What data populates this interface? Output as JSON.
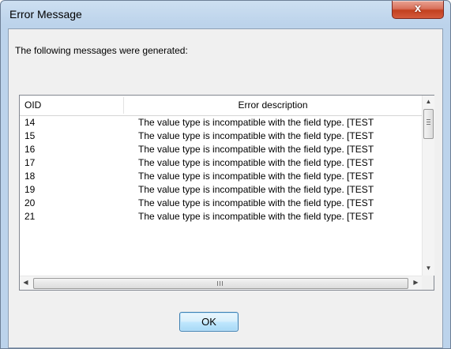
{
  "window": {
    "title": "Error Message",
    "close_label": "x"
  },
  "intro": "The following messages were generated:",
  "table": {
    "columns": [
      "OID",
      "Error description"
    ],
    "rows": [
      {
        "oid": "14",
        "desc": "The value type is incompatible with the field type. [TEST"
      },
      {
        "oid": "15",
        "desc": "The value type is incompatible with the field type. [TEST"
      },
      {
        "oid": "16",
        "desc": "The value type is incompatible with the field type. [TEST"
      },
      {
        "oid": "17",
        "desc": "The value type is incompatible with the field type. [TEST"
      },
      {
        "oid": "18",
        "desc": "The value type is incompatible with the field type. [TEST"
      },
      {
        "oid": "19",
        "desc": "The value type is incompatible with the field type. [TEST"
      },
      {
        "oid": "20",
        "desc": "The value type is incompatible with the field type. [TEST"
      },
      {
        "oid": "21",
        "desc": "The value type is incompatible with the field type. [TEST"
      }
    ]
  },
  "icons": {
    "scroll_up": "▲",
    "scroll_down": "▼",
    "scroll_left": "◀",
    "scroll_right": "▶",
    "hgrip": "III"
  },
  "ok_label": "OK"
}
